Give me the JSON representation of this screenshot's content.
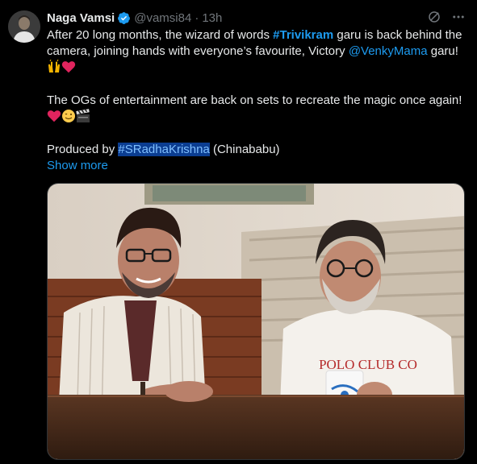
{
  "author": {
    "name": "Naga Vamsi",
    "handle": "@vamsi84",
    "separator": "·",
    "time": "13h"
  },
  "tweet": {
    "line1_pre": "After 20 long months, the wizard of words ",
    "line1_hashtag": "#Trivikram",
    "line1_post": " garu is back behind the camera, joining hands with everyone’s favourite, Victory ",
    "line1_mention": "@VenkyMama",
    "line1_end": " garu! ",
    "para2": "The OGs of entertainment are back on sets to recreate the magic once again! ",
    "para3_pre": "Produced by ",
    "para3_hashtag": "#SRadhaKrishna",
    "para3_post": " (Chinababu)",
    "show_more": "Show more"
  },
  "photo": {
    "mug_text": "POLO CLUB CO"
  },
  "colors": {
    "link": "#1d9bf0",
    "background": "#000000",
    "text": "#e7e9ea",
    "muted": "#71767b",
    "heart": "#f91880"
  },
  "icons": {
    "verified": "verified-badge-icon",
    "grok": "grok-icon",
    "more": "more-options-icon"
  }
}
